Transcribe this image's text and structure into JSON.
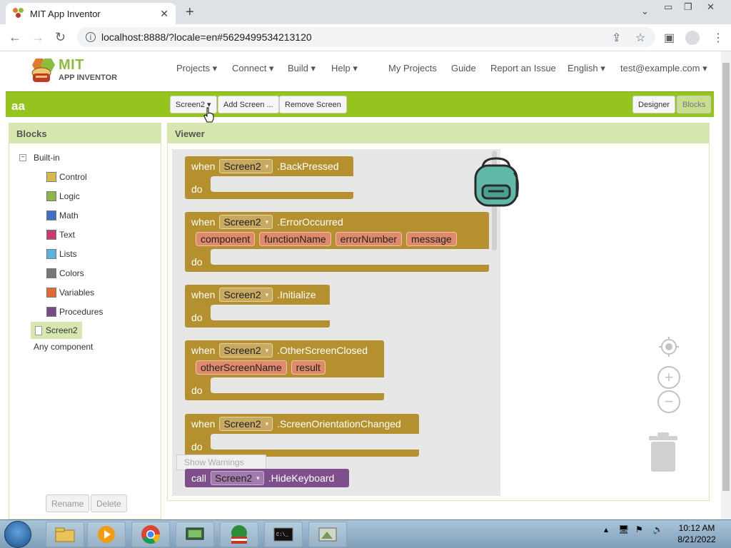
{
  "browser": {
    "tab_title": "MIT App Inventor",
    "url": "localhost:8888/?locale=en#5629499534213120"
  },
  "header": {
    "logo_mit": "MIT",
    "logo_sub": "APP INVENTOR",
    "menus": [
      "Projects ▾",
      "Connect ▾",
      "Build ▾",
      "Help ▾"
    ],
    "links": [
      "My Projects",
      "Guide",
      "Report an Issue",
      "English ▾",
      "test@example.com ▾"
    ]
  },
  "projectbar": {
    "project_name": "aa",
    "screen_select": "Screen2 ▾",
    "add_screen": "Add Screen ...",
    "remove_screen": "Remove Screen",
    "designer": "Designer",
    "blocks": "Blocks"
  },
  "blocks_panel": {
    "title": "Blocks",
    "collapse": "−",
    "builtin": "Built-in",
    "drawers": [
      {
        "label": "Control",
        "color": "#d9b84b"
      },
      {
        "label": "Logic",
        "color": "#8db54a"
      },
      {
        "label": "Math",
        "color": "#3f6ec6"
      },
      {
        "label": "Text",
        "color": "#c83d6e"
      },
      {
        "label": "Lists",
        "color": "#5bb2e0"
      },
      {
        "label": "Colors",
        "color": "#777777"
      },
      {
        "label": "Variables",
        "color": "#e06a33"
      },
      {
        "label": "Procedures",
        "color": "#7a4a88"
      }
    ],
    "screen_item": "Screen2",
    "any_component": "Any component",
    "rename": "Rename",
    "delete": "Delete"
  },
  "viewer": {
    "title": "Viewer",
    "when": "when",
    "do": "do",
    "call": "call",
    "component": "Screen2",
    "events": [
      ".BackPressed",
      ".ErrorOccurred",
      ".Initialize",
      ".OtherScreenClosed",
      ".ScreenOrientationChanged"
    ],
    "error_params": [
      "component",
      "functionName",
      "errorNumber",
      "message"
    ],
    "closed_params": [
      "otherScreenName",
      "result"
    ],
    "method": ".HideKeyboard",
    "show_warnings": "Show Warnings"
  },
  "taskbar": {
    "time": "10:12 AM",
    "date": "8/21/2022"
  }
}
